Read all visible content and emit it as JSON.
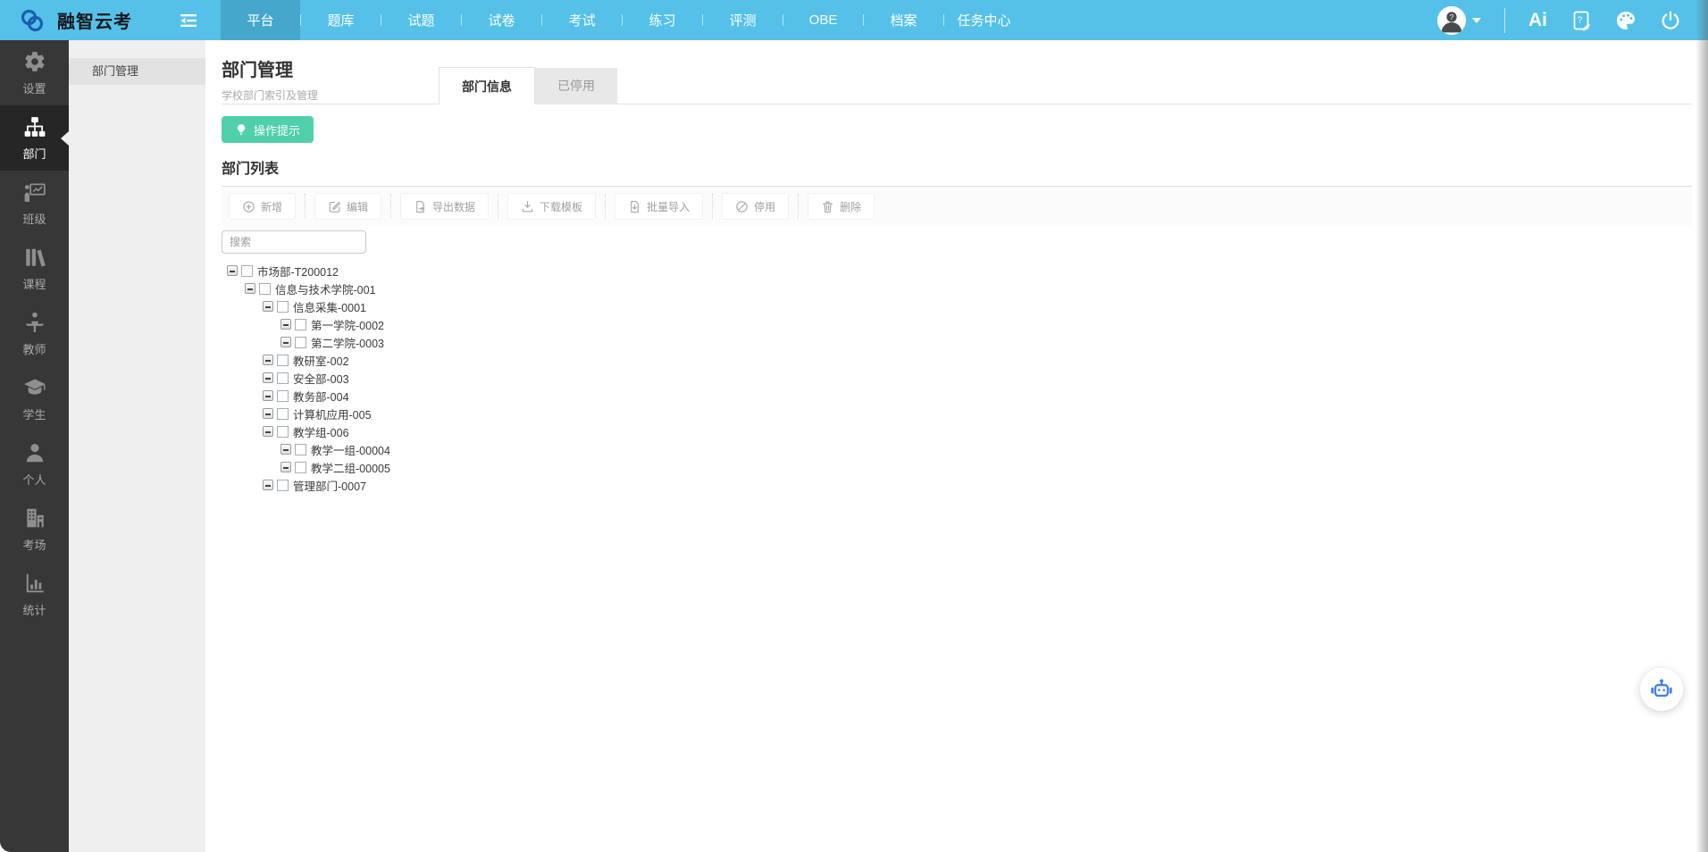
{
  "topbar": {
    "brand": "融智云考",
    "nav": [
      {
        "label": "平台",
        "active": true
      },
      {
        "label": "题库",
        "active": false
      },
      {
        "label": "试题",
        "active": false
      },
      {
        "label": "试卷",
        "active": false
      },
      {
        "label": "考试",
        "active": false
      },
      {
        "label": "练习",
        "active": false
      },
      {
        "label": "评测",
        "active": false
      },
      {
        "label": "OBE",
        "active": false
      },
      {
        "label": "档案",
        "active": false
      },
      {
        "label": "任务中心",
        "active": false
      }
    ],
    "right": {
      "ai_label": "Ai"
    }
  },
  "sidebar": {
    "items": [
      {
        "label": "设置",
        "icon": "gear-icon",
        "active": false
      },
      {
        "label": "部门",
        "icon": "orgchart-icon",
        "active": true
      },
      {
        "label": "班级",
        "icon": "classroom-icon",
        "active": false
      },
      {
        "label": "课程",
        "icon": "books-icon",
        "active": false
      },
      {
        "label": "教师",
        "icon": "teacher-icon",
        "active": false
      },
      {
        "label": "学生",
        "icon": "graduation-cap-icon",
        "active": false
      },
      {
        "label": "个人",
        "icon": "person-icon",
        "active": false
      },
      {
        "label": "考场",
        "icon": "building-icon",
        "active": false
      },
      {
        "label": "统计",
        "icon": "bar-chart-icon",
        "active": false
      }
    ]
  },
  "submenu": {
    "items": [
      {
        "label": "部门管理",
        "active": true
      }
    ]
  },
  "main": {
    "title": "部门管理",
    "subtitle": "学校部门索引及管理",
    "tabs": [
      {
        "label": "部门信息",
        "active": true
      },
      {
        "label": "已停用",
        "active": false
      }
    ],
    "tip_button_label": "操作提示",
    "section_title": "部门列表",
    "toolbar": [
      {
        "label": "新增",
        "icon": "plus-circle-icon"
      },
      {
        "label": "编辑",
        "icon": "edit-icon"
      },
      {
        "label": "导出数据",
        "icon": "export-icon"
      },
      {
        "label": "下载模板",
        "icon": "download-icon"
      },
      {
        "label": "批量导入",
        "icon": "import-icon"
      },
      {
        "label": "停用",
        "icon": "ban-icon"
      },
      {
        "label": "删除",
        "icon": "trash-icon"
      }
    ],
    "search_placeholder": "搜索",
    "tree": [
      {
        "label": "市场部-T200012",
        "level": 0
      },
      {
        "label": "信息与技术学院-001",
        "level": 1
      },
      {
        "label": "信息采集-0001",
        "level": 2
      },
      {
        "label": "第一学院-0002",
        "level": 3
      },
      {
        "label": "第二学院-0003",
        "level": 3
      },
      {
        "label": "教研室-002",
        "level": 2
      },
      {
        "label": "安全部-003",
        "level": 2
      },
      {
        "label": "教务部-004",
        "level": 2
      },
      {
        "label": "计算机应用-005",
        "level": 2
      },
      {
        "label": "教学组-006",
        "level": 2
      },
      {
        "label": "教学一组-00004",
        "level": 3
      },
      {
        "label": "教学二组-00005",
        "level": 3
      },
      {
        "label": "管理部门-0007",
        "level": 2
      }
    ]
  },
  "colors": {
    "topbar": "#55c1e9",
    "topbar_active": "#46a7cc",
    "sidebar_bg": "#373737",
    "sidebar_active_bg": "#262626",
    "accent_green": "#4fd0aa",
    "logo_blue": "#1b5fb0",
    "robot_blue": "#4080ef"
  }
}
